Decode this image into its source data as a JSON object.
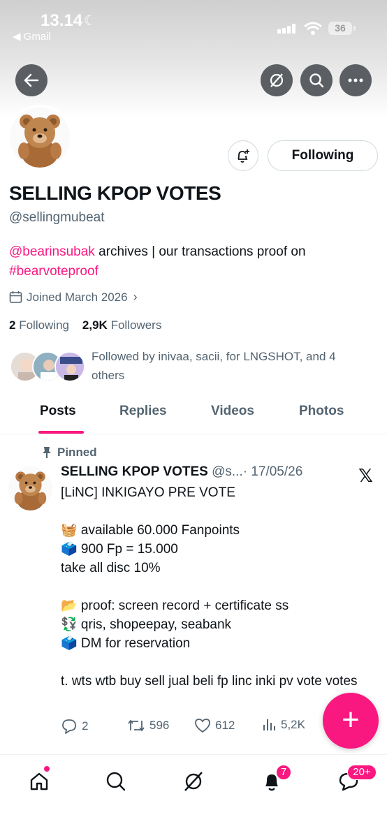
{
  "status_bar": {
    "time": "13.14",
    "back_app": "◀ Gmail",
    "battery": "36"
  },
  "profile": {
    "name": "SELLING KPOP VOTES",
    "handle": "@sellingmubeat",
    "bio_mention": "@bearinsubak",
    "bio_text": " archives | our transactions proof on ",
    "bio_hashtag": "#bearvoteproof",
    "joined": "Joined March 2026",
    "following_count": "2",
    "following_label": "Following",
    "followers_count": "2,9K",
    "followers_label": "Followers",
    "followed_by": "Followed by inivaa, sacii, for LNGSHOT, and 4 others",
    "following_button": "Following"
  },
  "tabs": [
    {
      "label": "Posts",
      "active": true
    },
    {
      "label": "Replies",
      "active": false
    },
    {
      "label": "Videos",
      "active": false
    },
    {
      "label": "Photos",
      "active": false
    }
  ],
  "post": {
    "pinned_label": "Pinned",
    "author": "SELLING KPOP VOTES",
    "handle_truncated": "@s...",
    "date": "· 17/05/26",
    "body": "[LiNC] INKIGAYO PRE VOTE\n\n🧺 available 60.000 Fanpoints\n🗳️ 900 Fp = 15.000\ntake all disc 10%\n\n📂 proof: screen record + certificate ss\n💱 qris, shopeepay, seabank\n🗳️ DM for reservation\n\nt. wts wtb buy sell jual beli fp linc inki pv vote votes",
    "replies": "2",
    "reposts": "596",
    "likes": "612",
    "views": "5,2K"
  },
  "bottom_nav": {
    "notifications_badge": "7",
    "messages_badge": "20+"
  },
  "colors": {
    "accent": "#f91880",
    "secondary_text": "#536471",
    "primary_text": "#0f1419"
  },
  "icons": [
    "back-arrow-icon",
    "grok-icon",
    "search-icon",
    "more-icon",
    "bell-plus-icon",
    "calendar-icon",
    "chevron-right-icon",
    "pin-icon",
    "x-logo-icon",
    "reply-icon",
    "repost-icon",
    "like-icon",
    "views-icon",
    "plus-icon",
    "home-icon",
    "notifications-icon",
    "messages-icon"
  ]
}
